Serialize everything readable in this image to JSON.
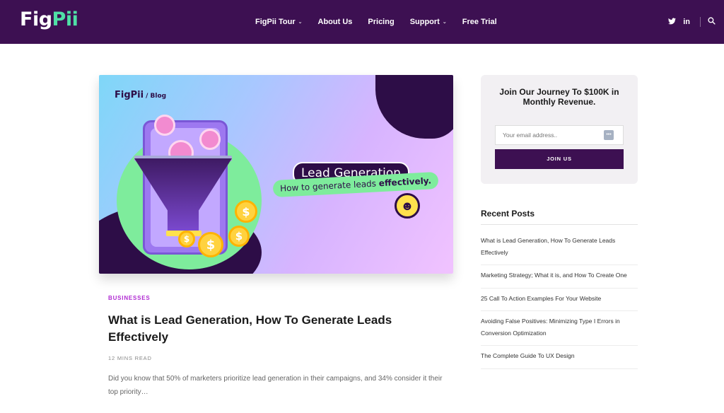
{
  "brand": {
    "logo_part1": "Fig",
    "logo_part2": "Pii"
  },
  "nav": {
    "items": [
      {
        "label": "FigPii Tour",
        "has_dropdown": true
      },
      {
        "label": "About Us",
        "has_dropdown": false
      },
      {
        "label": "Pricing",
        "has_dropdown": false
      },
      {
        "label": "Support",
        "has_dropdown": true
      },
      {
        "label": "Free Trial",
        "has_dropdown": false
      }
    ],
    "social": {
      "twitter": "twitter-icon",
      "linkedin_label": "in"
    },
    "search_icon": "search-icon"
  },
  "hero": {
    "brand": "FigPii",
    "brand_suffix": "/ Blog",
    "tag_title": "Lead Generation",
    "tag_subtitle": "How to generate leads",
    "tag_subtitle_bold": "effectively.",
    "coin_symbol": "$"
  },
  "post": {
    "category": "BUSINESSES",
    "title": "What is Lead Generation, How To Generate Leads Effectively",
    "meta": "12 MINS READ",
    "excerpt": "Did you know that 50% of marketers prioritize lead generation in their campaigns, and 34% consider it their top priority…"
  },
  "newsletter": {
    "title": "Join Our Journey To $100K in Monthly Revenue.",
    "email_placeholder": "Your email address..",
    "button_label": "JOIN US"
  },
  "recent_posts": {
    "title": "Recent Posts",
    "items": [
      "What is Lead Generation, How To Generate Leads Effectively",
      "Marketing Strategy; What it is, and How To Create One",
      "25 Call To Action Examples For Your Website",
      "Avoiding False Positives: Minimizing Type I Errors in Conversion Optimization",
      "The Complete Guide To UX Design"
    ]
  },
  "colors": {
    "nav_bg": "#3d1052",
    "accent_green": "#4fe0a6",
    "category": "#b02ad2"
  }
}
